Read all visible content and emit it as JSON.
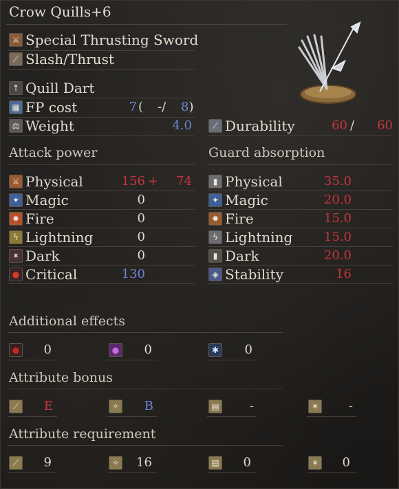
{
  "weapon": {
    "name": "Crow Quills+6",
    "type": "Special Thrusting Sword",
    "attack_type": "Slash/Thrust",
    "skill": "Quill Dart",
    "fp_label": "FP cost",
    "fp_value": "7",
    "fp_open": "(",
    "fp_sep": "-/",
    "fp_max": "8)",
    "weight_label": "Weight",
    "weight_value": "4.0",
    "durability_label": "Durability",
    "durability_value": "60",
    "durability_sep": "/",
    "durability_max": "60"
  },
  "attack_power": {
    "title": "Attack power",
    "rows": [
      {
        "label": "Physical",
        "value": "156",
        "plus": "+",
        "bonus": "74",
        "icon": "sword-physical-icon"
      },
      {
        "label": "Magic",
        "value": "0",
        "icon": "magic-icon"
      },
      {
        "label": "Fire",
        "value": "0",
        "icon": "fire-icon"
      },
      {
        "label": "Lightning",
        "value": "0",
        "icon": "lightning-icon"
      },
      {
        "label": "Dark",
        "value": "0",
        "icon": "dark-icon"
      },
      {
        "label": "Critical",
        "value": "130",
        "icon": "critical-icon"
      }
    ]
  },
  "guard_absorption": {
    "title": "Guard absorption",
    "rows": [
      {
        "label": "Physical",
        "value": "35.0",
        "icon": "shield-physical-icon"
      },
      {
        "label": "Magic",
        "value": "20.0",
        "icon": "shield-magic-icon"
      },
      {
        "label": "Fire",
        "value": "15.0",
        "icon": "shield-fire-icon"
      },
      {
        "label": "Lightning",
        "value": "15.0",
        "icon": "shield-lightning-icon"
      },
      {
        "label": "Dark",
        "value": "20.0",
        "icon": "shield-dark-icon"
      },
      {
        "label": "Stability",
        "value": "16",
        "icon": "stability-icon"
      }
    ]
  },
  "additional_effects": {
    "title": "Additional effects",
    "items": [
      {
        "icon": "bleed-icon",
        "value": "0"
      },
      {
        "icon": "poison-icon",
        "value": "0"
      },
      {
        "icon": "frost-icon",
        "value": "0"
      }
    ]
  },
  "attribute_bonus": {
    "title": "Attribute bonus",
    "items": [
      {
        "icon": "strength-icon",
        "value": "E"
      },
      {
        "icon": "dexterity-icon",
        "value": "B"
      },
      {
        "icon": "intelligence-icon",
        "value": "-"
      },
      {
        "icon": "faith-icon",
        "value": "-"
      }
    ]
  },
  "attribute_requirement": {
    "title": "Attribute requirement",
    "items": [
      {
        "icon": "strength-icon",
        "value": "9"
      },
      {
        "icon": "dexterity-icon",
        "value": "16"
      },
      {
        "icon": "intelligence-icon",
        "value": "0"
      },
      {
        "icon": "faith-icon",
        "value": "0"
      }
    ]
  },
  "colors": {
    "blue_value": "#6c86d6",
    "red_value": "#c8353b",
    "text": "#e1dacd",
    "background": "#1d1b19"
  }
}
